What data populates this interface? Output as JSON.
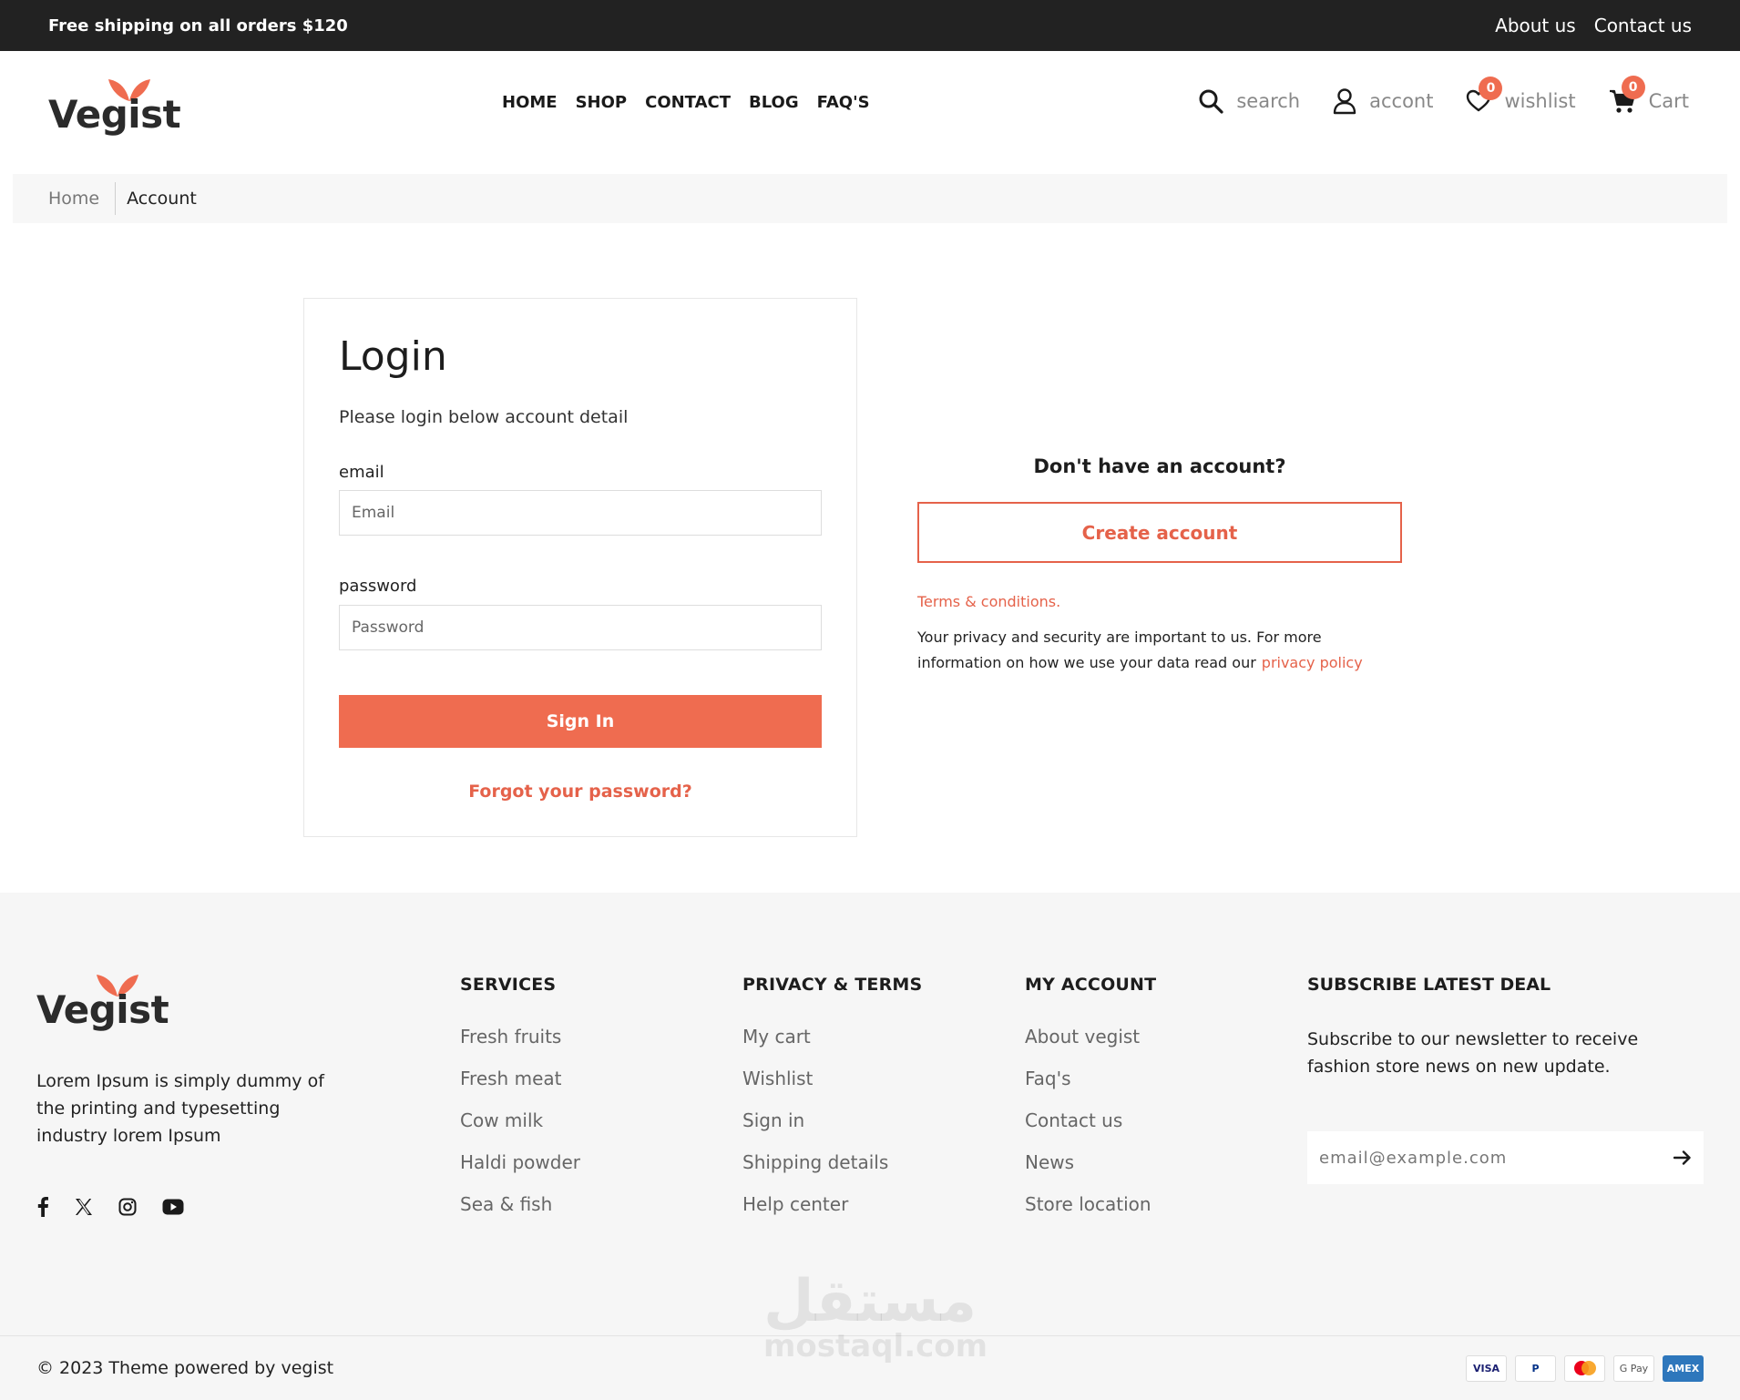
{
  "topbar": {
    "promo": "Free shipping on all orders $120",
    "links": [
      "About us",
      "Contact us"
    ]
  },
  "brand": {
    "name": "Vegist",
    "accent_color": "#ef6c50",
    "logo_icon": "leaf-icon"
  },
  "nav": [
    "HOME",
    "SHOP",
    "CONTACT",
    "BLOG",
    "FAQ'S"
  ],
  "header_utils": {
    "search_label": "search",
    "account_label": "accont",
    "wishlist_label": "wishlist",
    "wishlist_count": "0",
    "cart_label": "Cart",
    "cart_count": "0"
  },
  "breadcrumb": {
    "home": "Home",
    "current": "Account"
  },
  "login": {
    "title": "Login",
    "subtitle": "Please login below account detail",
    "email_label": "email",
    "email_placeholder": "Email",
    "password_label": "password",
    "password_placeholder": "Password",
    "signin_label": "Sign In",
    "forgot_label": "Forgot your password?"
  },
  "register": {
    "question": "Don't have an account?",
    "create_label": "Create account",
    "terms_label": "Terms & conditions.",
    "privacy_text": "Your privacy and security are important to us. For more information on how we use your data read our",
    "privacy_link": "privacy policy"
  },
  "footer": {
    "about": "Lorem Ipsum is simply dummy of the printing and typesetting industry lorem Ipsum",
    "socials": [
      "facebook-icon",
      "x-icon",
      "instagram-icon",
      "youtube-icon"
    ],
    "columns": [
      {
        "title": "SERVICES",
        "items": [
          "Fresh fruits",
          "Fresh meat",
          "Cow milk",
          "Haldi powder",
          "Sea & fish"
        ]
      },
      {
        "title": "PRIVACY & TERMS",
        "items": [
          "My cart",
          "Wishlist",
          "Sign in",
          "Shipping details",
          "Help center"
        ]
      },
      {
        "title": "MY ACCOUNT",
        "items": [
          "About vegist",
          "Faq's",
          "Contact us",
          "News",
          "Store location"
        ]
      }
    ],
    "subscribe": {
      "title": "SUBSCRIBE LATEST DEAL",
      "text": "Subscribe to our newsletter to receive fashion store news on new update.",
      "placeholder": "email@example.com"
    },
    "copyright": "© 2023 Theme powered by vegist",
    "payments": [
      "VISA",
      "P",
      "",
      "G Pay",
      "AMEX"
    ]
  },
  "watermark": {
    "arabic": "مستقل",
    "latin": "mostaql.com"
  }
}
